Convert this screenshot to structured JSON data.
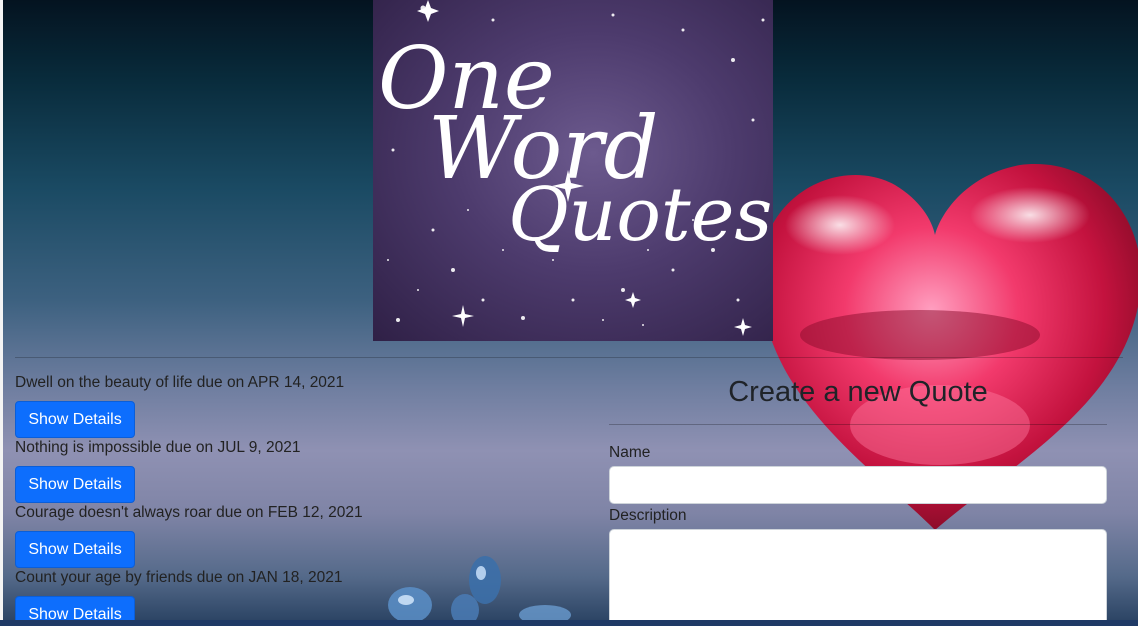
{
  "logo": {
    "line1": "One",
    "line2": "Word",
    "line3": "Quotes"
  },
  "quotes": [
    {
      "text": "Dwell on the beauty of life due on APR 14, 2021",
      "button": "Show Details"
    },
    {
      "text": "Nothing is impossible due on JUL 9, 2021",
      "button": "Show Details"
    },
    {
      "text": "Courage doesn't always roar due on FEB 12, 2021",
      "button": "Show Details"
    },
    {
      "text": "Count your age by friends due on JAN 18, 2021",
      "button": "Show Details"
    }
  ],
  "form": {
    "title": "Create a new Quote",
    "name_label": "Name",
    "name_value": "",
    "description_label": "Description",
    "description_value": ""
  },
  "colors": {
    "button": "#0d6efd",
    "logo_bg": "#4d3b6d"
  }
}
